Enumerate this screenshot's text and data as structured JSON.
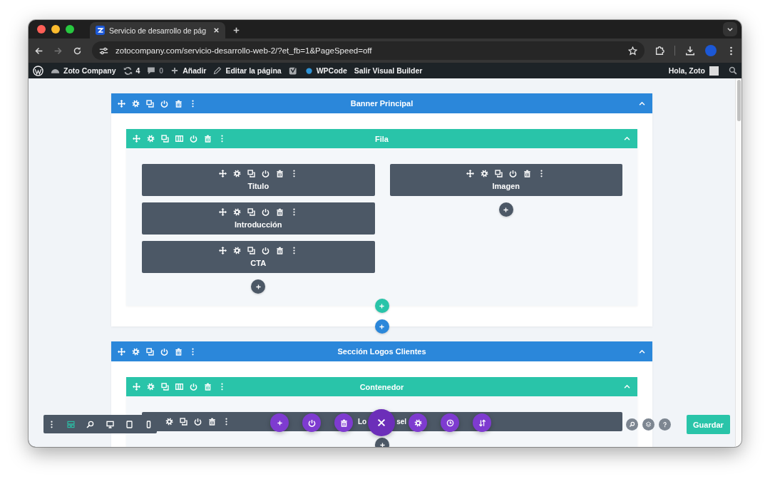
{
  "browser": {
    "tab": {
      "title": "Servicio de desarrollo de pág",
      "selected": true
    },
    "url": "zotocompany.com/servicio-desarrollo-web-2/?et_fb=1&PageSpeed=off"
  },
  "admin_bar": {
    "site": "Zoto Company",
    "updates": "4",
    "comments": "0",
    "new": "Añadir",
    "edit": "Editar la página",
    "wpcode": "WPCode",
    "exit_builder": "Salir Visual Builder",
    "greeting": "Hola, Zoto"
  },
  "sections": [
    {
      "title": "Banner Principal",
      "expanded": true,
      "rows": [
        {
          "title": "Fila",
          "expanded": true,
          "columns": [
            {
              "modules": [
                {
                  "kind": "stacked",
                  "title": "Titulo"
                },
                {
                  "kind": "stacked",
                  "title": "Introducción"
                },
                {
                  "kind": "stacked",
                  "title": "CTA"
                }
              ]
            },
            {
              "modules": [
                {
                  "kind": "stacked",
                  "title": "Imagen"
                }
              ]
            }
          ]
        }
      ]
    },
    {
      "title": "Sección Logos Clientes",
      "expanded": true,
      "rows": [
        {
          "title": "Contenedor",
          "expanded": true,
          "columns": [
            {
              "modules": [
                {
                  "kind": "inline",
                  "title_start": "Lo",
                  "title_end": "sel"
                }
              ]
            }
          ]
        }
      ]
    }
  ],
  "view_modes": [
    {
      "kind": "wireframe",
      "selected": true
    },
    {
      "kind": "zoom",
      "selected": false
    },
    {
      "kind": "desktop",
      "selected": false
    },
    {
      "kind": "tablet",
      "selected": false
    },
    {
      "kind": "phone",
      "selected": false
    }
  ],
  "save_button": "Guardar"
}
